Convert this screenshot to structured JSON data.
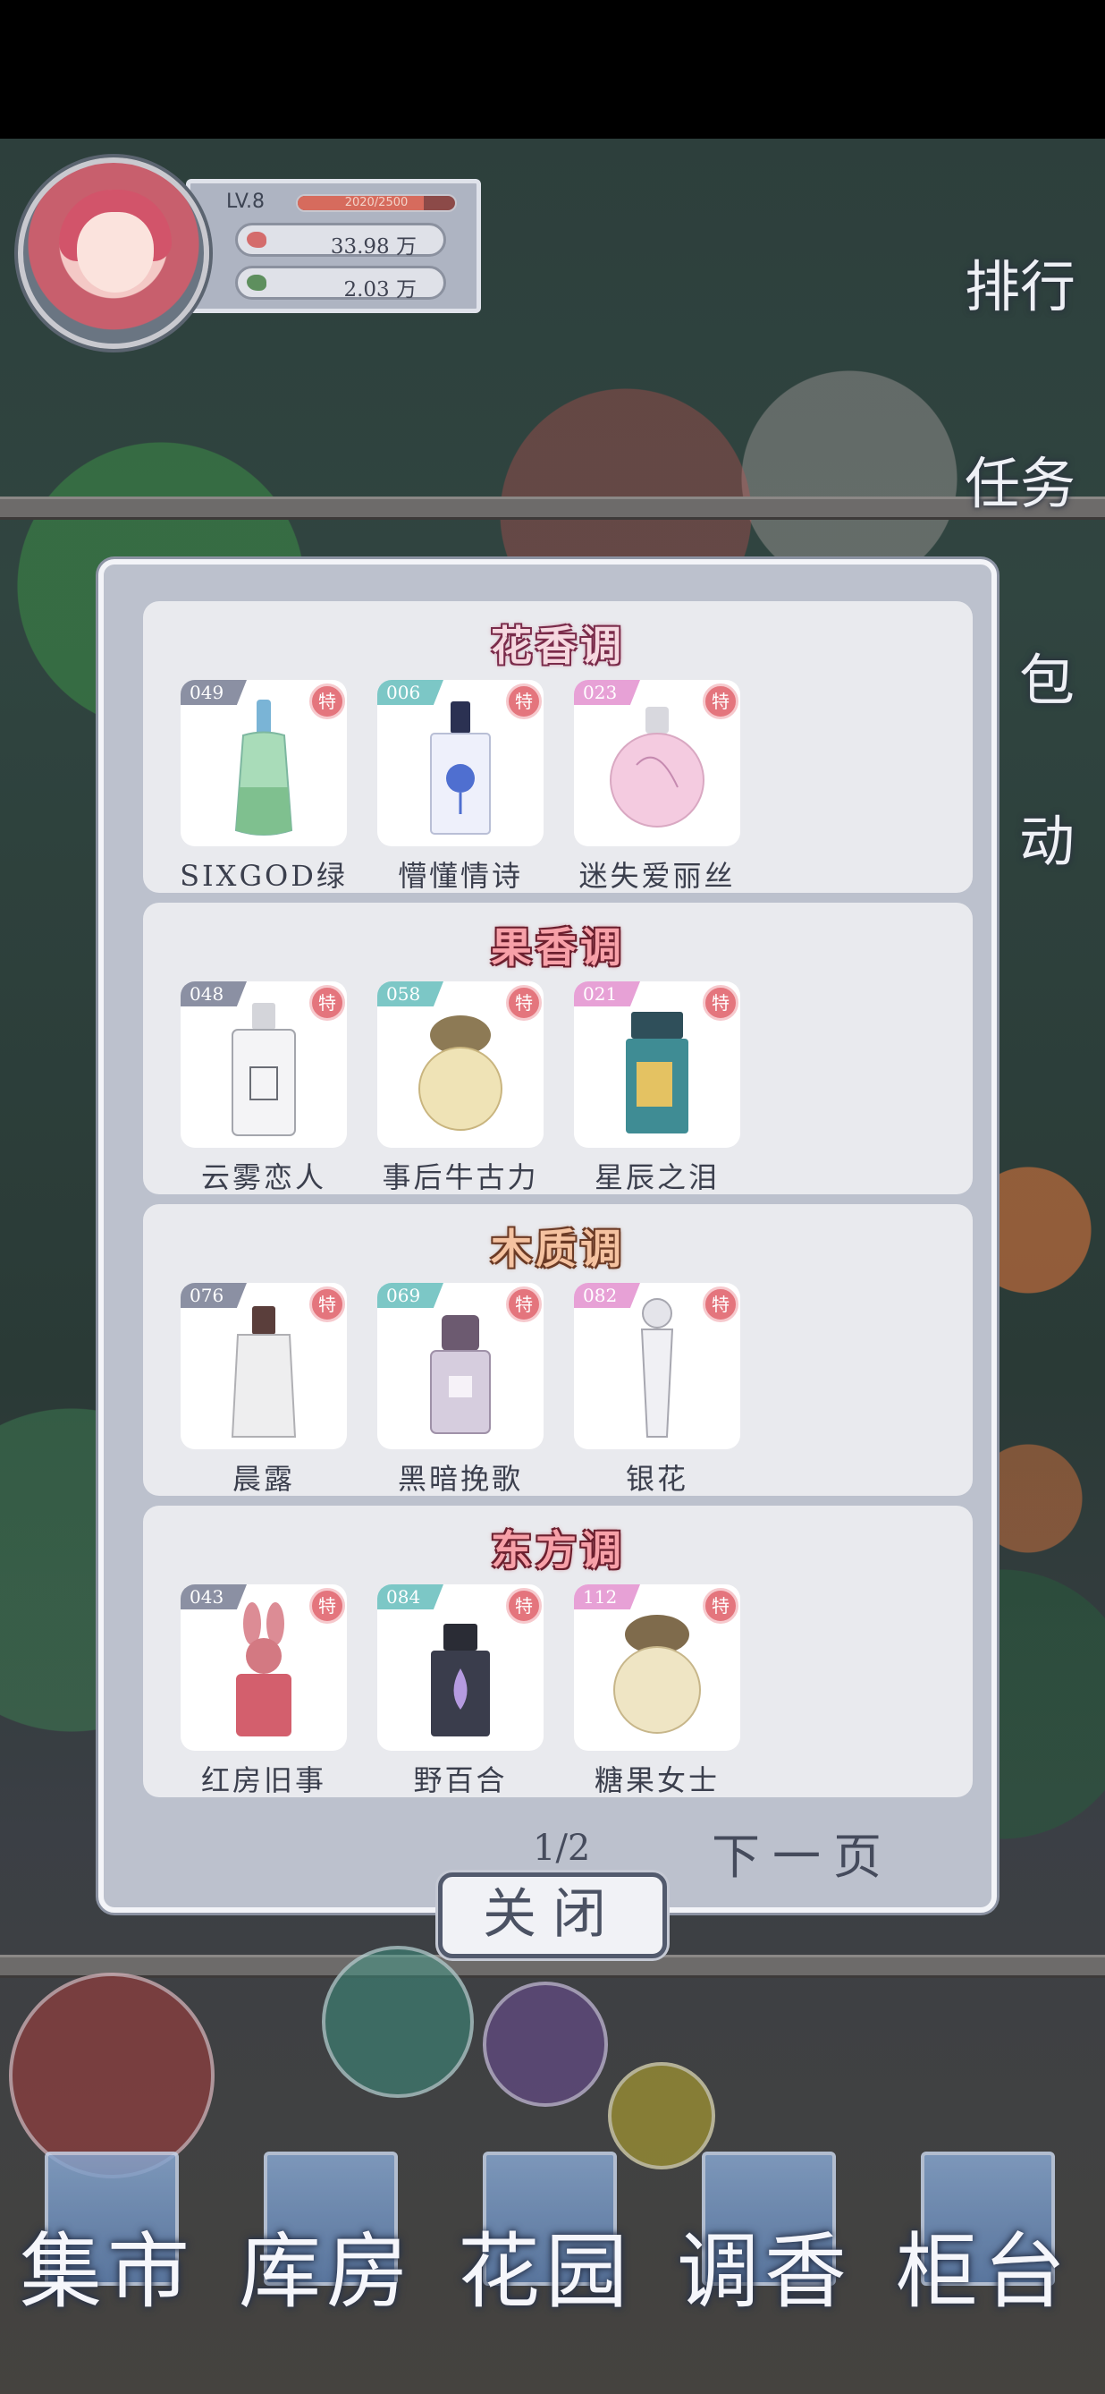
{
  "player": {
    "level": "LV.8",
    "exp_text": "2020/2500",
    "exp_fraction": 0.8,
    "currency_red": "33.98 万",
    "currency_green": "2.03 万"
  },
  "side_menu": {
    "rank": "排行",
    "tasks": "任务",
    "bag": "包",
    "events": "动"
  },
  "collection": {
    "categories": [
      {
        "title": "花香调",
        "items": [
          {
            "id": "049",
            "name": "SIXGOD绿",
            "special": "特",
            "badge_color": "#8b90a3"
          },
          {
            "id": "006",
            "name": "懵懂情诗",
            "special": "特",
            "badge_color": "#7cc7c6"
          },
          {
            "id": "023",
            "name": "迷失爱丽丝",
            "special": "特",
            "badge_color": "#e7a1d6"
          }
        ]
      },
      {
        "title": "果香调",
        "items": [
          {
            "id": "048",
            "name": "云雾恋人",
            "special": "特",
            "badge_color": "#8b90a3"
          },
          {
            "id": "058",
            "name": "事后牛古力",
            "special": "特",
            "badge_color": "#7cc7c6"
          },
          {
            "id": "021",
            "name": "星辰之泪",
            "special": "特",
            "badge_color": "#e7a1d6"
          }
        ]
      },
      {
        "title": "木质调",
        "items": [
          {
            "id": "076",
            "name": "晨露",
            "special": "特",
            "badge_color": "#8b90a3"
          },
          {
            "id": "069",
            "name": "黑暗挽歌",
            "special": "特",
            "badge_color": "#7cc7c6"
          },
          {
            "id": "082",
            "name": "银花",
            "special": "特",
            "badge_color": "#e7a1d6"
          }
        ]
      },
      {
        "title": "东方调",
        "items": [
          {
            "id": "043",
            "name": "红房旧事",
            "special": "特",
            "badge_color": "#8b90a3"
          },
          {
            "id": "084",
            "name": "野百合",
            "special": "特",
            "badge_color": "#7cc7c6"
          },
          {
            "id": "112",
            "name": "糖果女士",
            "special": "特",
            "badge_color": "#e7a1d6"
          }
        ]
      }
    ],
    "page": "1/2",
    "next_page": "下一页",
    "close": "关闭"
  },
  "bottom_nav": {
    "market": "集市",
    "warehouse": "库房",
    "garden": "花园",
    "blend": "调香",
    "counter": "柜台"
  }
}
